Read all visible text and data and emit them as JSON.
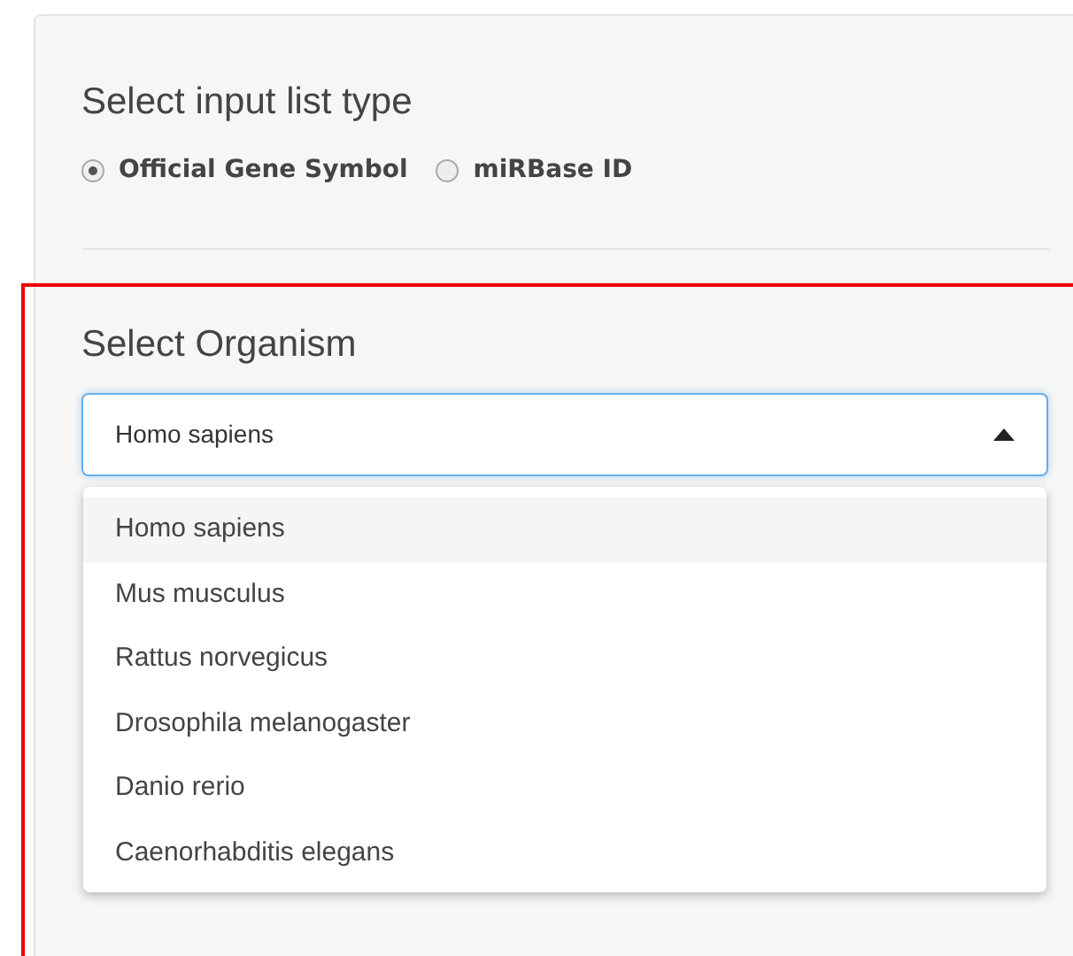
{
  "list_type": {
    "title": "Select input list type",
    "options": [
      {
        "label": "Official Gene Symbol",
        "selected": true
      },
      {
        "label": "miRBase ID",
        "selected": false
      }
    ]
  },
  "organism": {
    "title": "Select Organism",
    "value": "Homo sapiens",
    "expanded": true,
    "options": [
      {
        "label": "Homo sapiens",
        "selected": true
      },
      {
        "label": "Mus musculus",
        "selected": false
      },
      {
        "label": "Rattus norvegicus",
        "selected": false
      },
      {
        "label": "Drosophila melanogaster",
        "selected": false
      },
      {
        "label": "Danio rerio",
        "selected": false
      },
      {
        "label": "Caenorhabditis elegans",
        "selected": false
      }
    ]
  }
}
